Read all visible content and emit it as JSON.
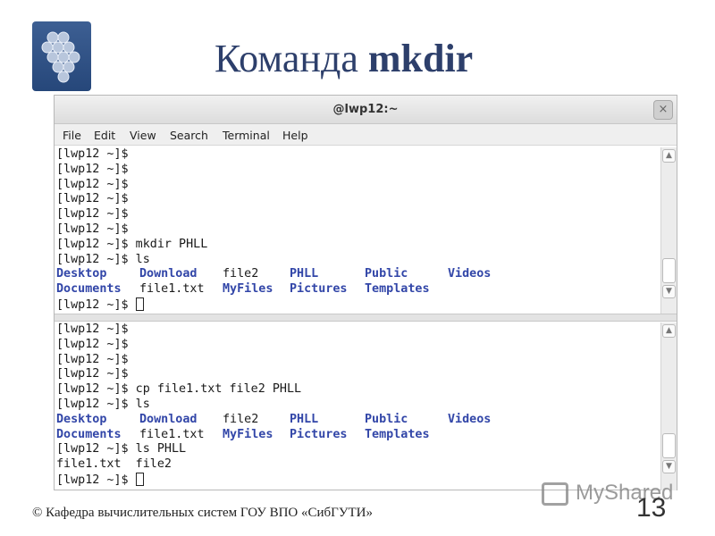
{
  "slide": {
    "title_plain": "Команда ",
    "title_bold": "mkdir",
    "footer": "© Кафедра вычислительных систем ГОУ ВПО «СибГУТИ»",
    "page_number": "13",
    "watermark": "MyShared"
  },
  "window": {
    "title": "@lwp12:~",
    "close_label": "×"
  },
  "menu": [
    "File",
    "Edit",
    "View",
    "Search",
    "Terminal",
    "Help"
  ],
  "top_pane": {
    "prompt_lines": [
      "[lwp12 ~]$",
      "[lwp12 ~]$",
      "[lwp12 ~]$",
      "[lwp12 ~]$",
      "[lwp12 ~]$",
      "[lwp12 ~]$",
      "[lwp12 ~]$ mkdir PHLL",
      "[lwp12 ~]$ ls"
    ],
    "ls_row1": [
      "Desktop",
      "Download",
      "file2",
      "PHLL",
      "Public",
      "Videos"
    ],
    "ls_row2": [
      "Documents",
      "file1.txt",
      "MyFiles",
      "Pictures",
      "Templates"
    ],
    "last_prompt": "[lwp12 ~]$ "
  },
  "bottom_pane": {
    "prompt_lines": [
      "[lwp12 ~]$",
      "[lwp12 ~]$",
      "[lwp12 ~]$",
      "[lwp12 ~]$",
      "[lwp12 ~]$ cp file1.txt file2 PHLL",
      "[lwp12 ~]$ ls"
    ],
    "ls_row1": [
      "Desktop",
      "Download",
      "file2",
      "PHLL",
      "Public",
      "Videos"
    ],
    "ls_row2": [
      "Documents",
      "file1.txt",
      "MyFiles",
      "Pictures",
      "Templates"
    ],
    "after_lines": [
      "[lwp12 ~]$ ls PHLL",
      "file1.txt  file2"
    ],
    "last_prompt": "[lwp12 ~]$ "
  },
  "colors": {
    "title": "#2d3f6b",
    "directory": "#3246a8"
  }
}
